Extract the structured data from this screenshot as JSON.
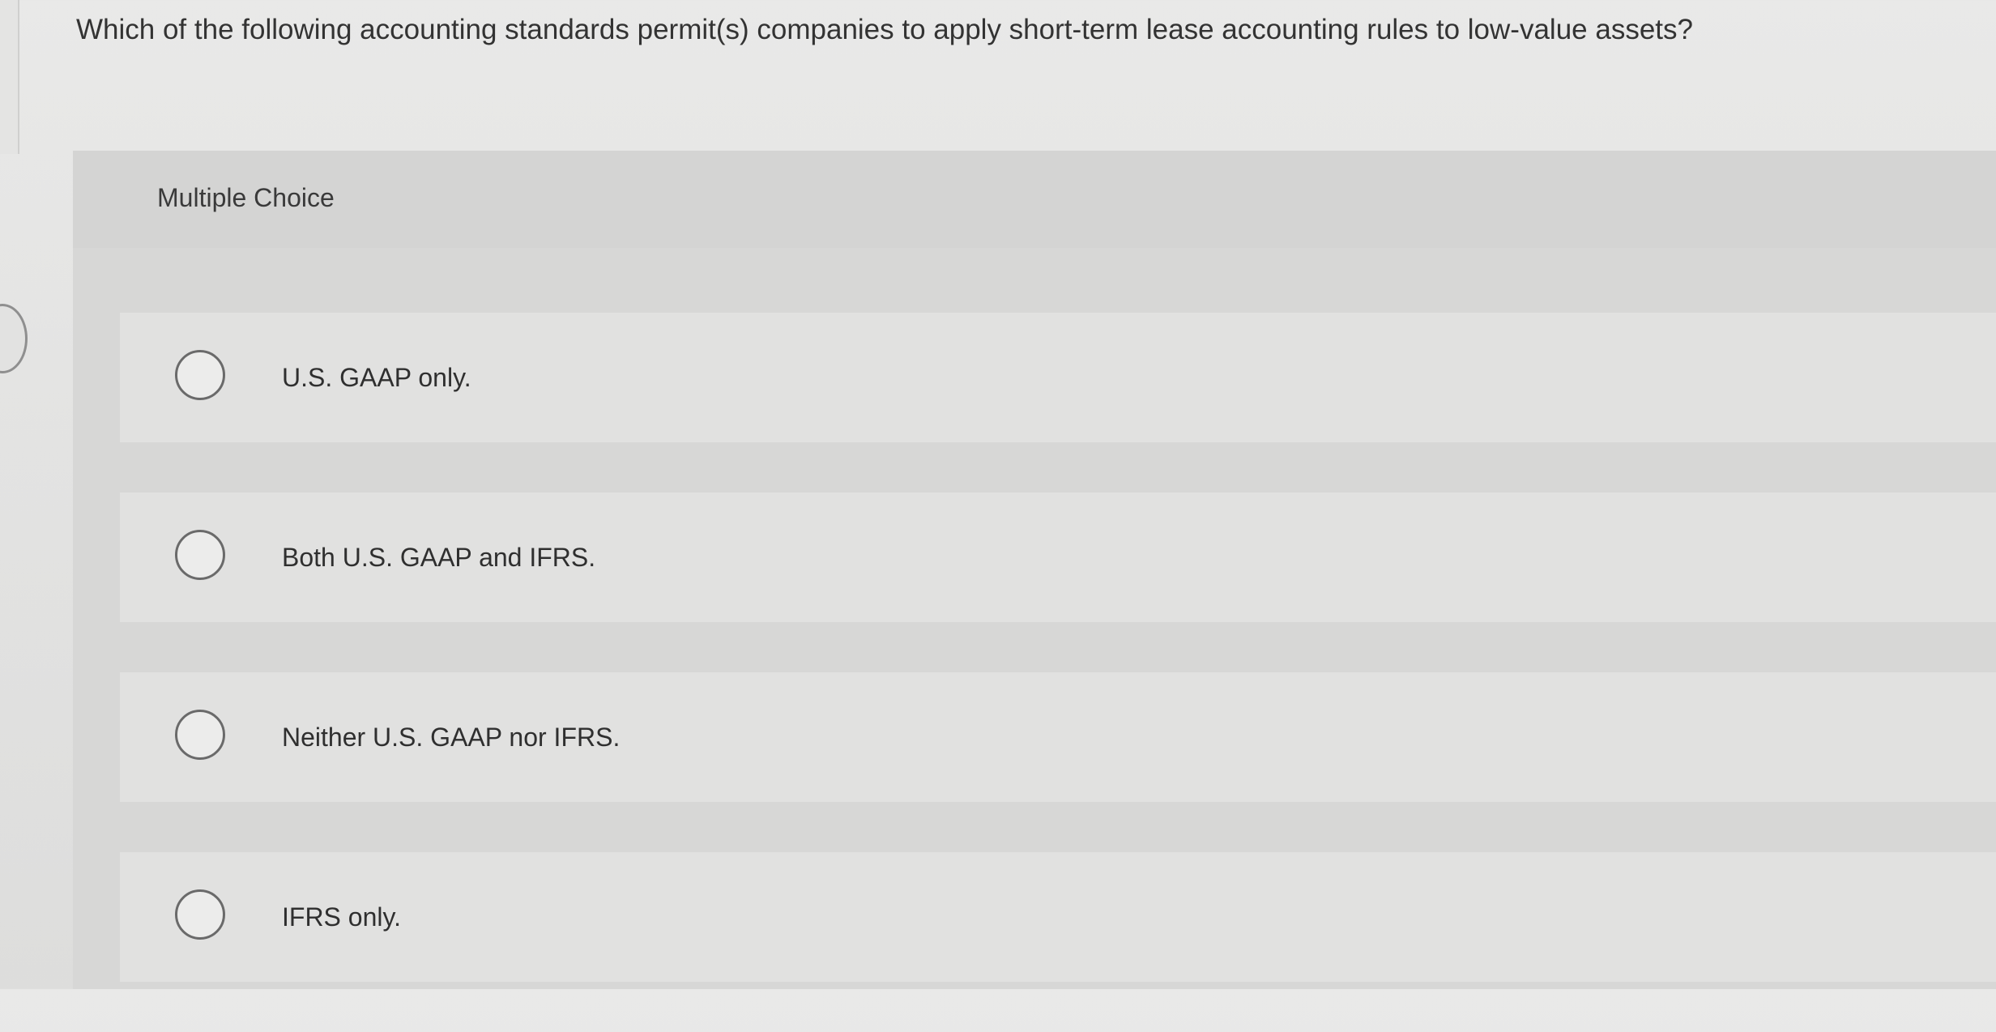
{
  "question": {
    "text": "Which of the following accounting standards permit(s) companies to apply short-term lease accounting rules to low-value assets?"
  },
  "panel": {
    "title": "Multiple Choice"
  },
  "options": [
    {
      "label": "U.S. GAAP only."
    },
    {
      "label": "Both U.S. GAAP and IFRS."
    },
    {
      "label": "Neither U.S. GAAP nor IFRS."
    },
    {
      "label": "IFRS only."
    }
  ],
  "colors": {
    "background": "#e4e4e3",
    "panel": "#d7d7d6",
    "option_row": "#e1e1e0",
    "radio_border": "#6a6a6a",
    "text": "#2f2f2f"
  },
  "icons": {
    "option_selector": "radio-circle-icon"
  }
}
